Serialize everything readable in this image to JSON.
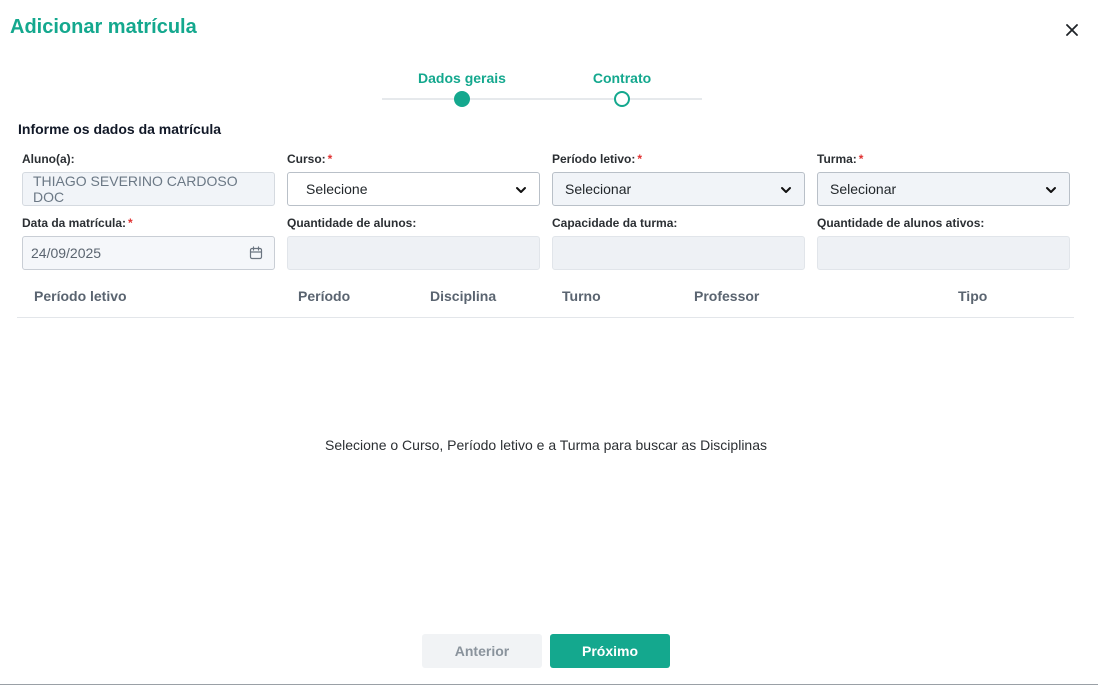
{
  "modal": {
    "title": "Adicionar matrícula",
    "close_icon": "close-icon"
  },
  "stepper": {
    "steps": [
      {
        "label": "Dados gerais",
        "state": "active"
      },
      {
        "label": "Contrato",
        "state": "pending"
      }
    ]
  },
  "form": {
    "section_title": "Informe os dados da matrícula",
    "required_mark": "*",
    "aluno": {
      "label": "Aluno(a):",
      "value": "THIAGO SEVERINO CARDOSO DOC"
    },
    "curso": {
      "label": "Curso:",
      "value": "Selecione"
    },
    "periodo_letivo": {
      "label": "Período letivo:",
      "value": "Selecionar"
    },
    "turma": {
      "label": "Turma:",
      "value": "Selecionar"
    },
    "data_matricula": {
      "label": "Data da matrícula:",
      "value": "24/09/2025"
    },
    "quantidade_alunos": {
      "label": "Quantidade de alunos:",
      "value": ""
    },
    "capacidade_turma": {
      "label": "Capacidade da turma:",
      "value": ""
    },
    "quantidade_alunos_ativos": {
      "label": "Quantidade de alunos ativos:",
      "value": ""
    }
  },
  "table": {
    "columns": [
      "Período letivo",
      "Período",
      "Disciplina",
      "Turno",
      "Professor",
      "Tipo"
    ],
    "empty_message": "Selecione o Curso, Período letivo e a Turma para buscar as Disciplinas"
  },
  "footer": {
    "prev_label": "Anterior",
    "next_label": "Próximo"
  },
  "colors": {
    "accent": "#14a88e",
    "required": "#e03131"
  }
}
